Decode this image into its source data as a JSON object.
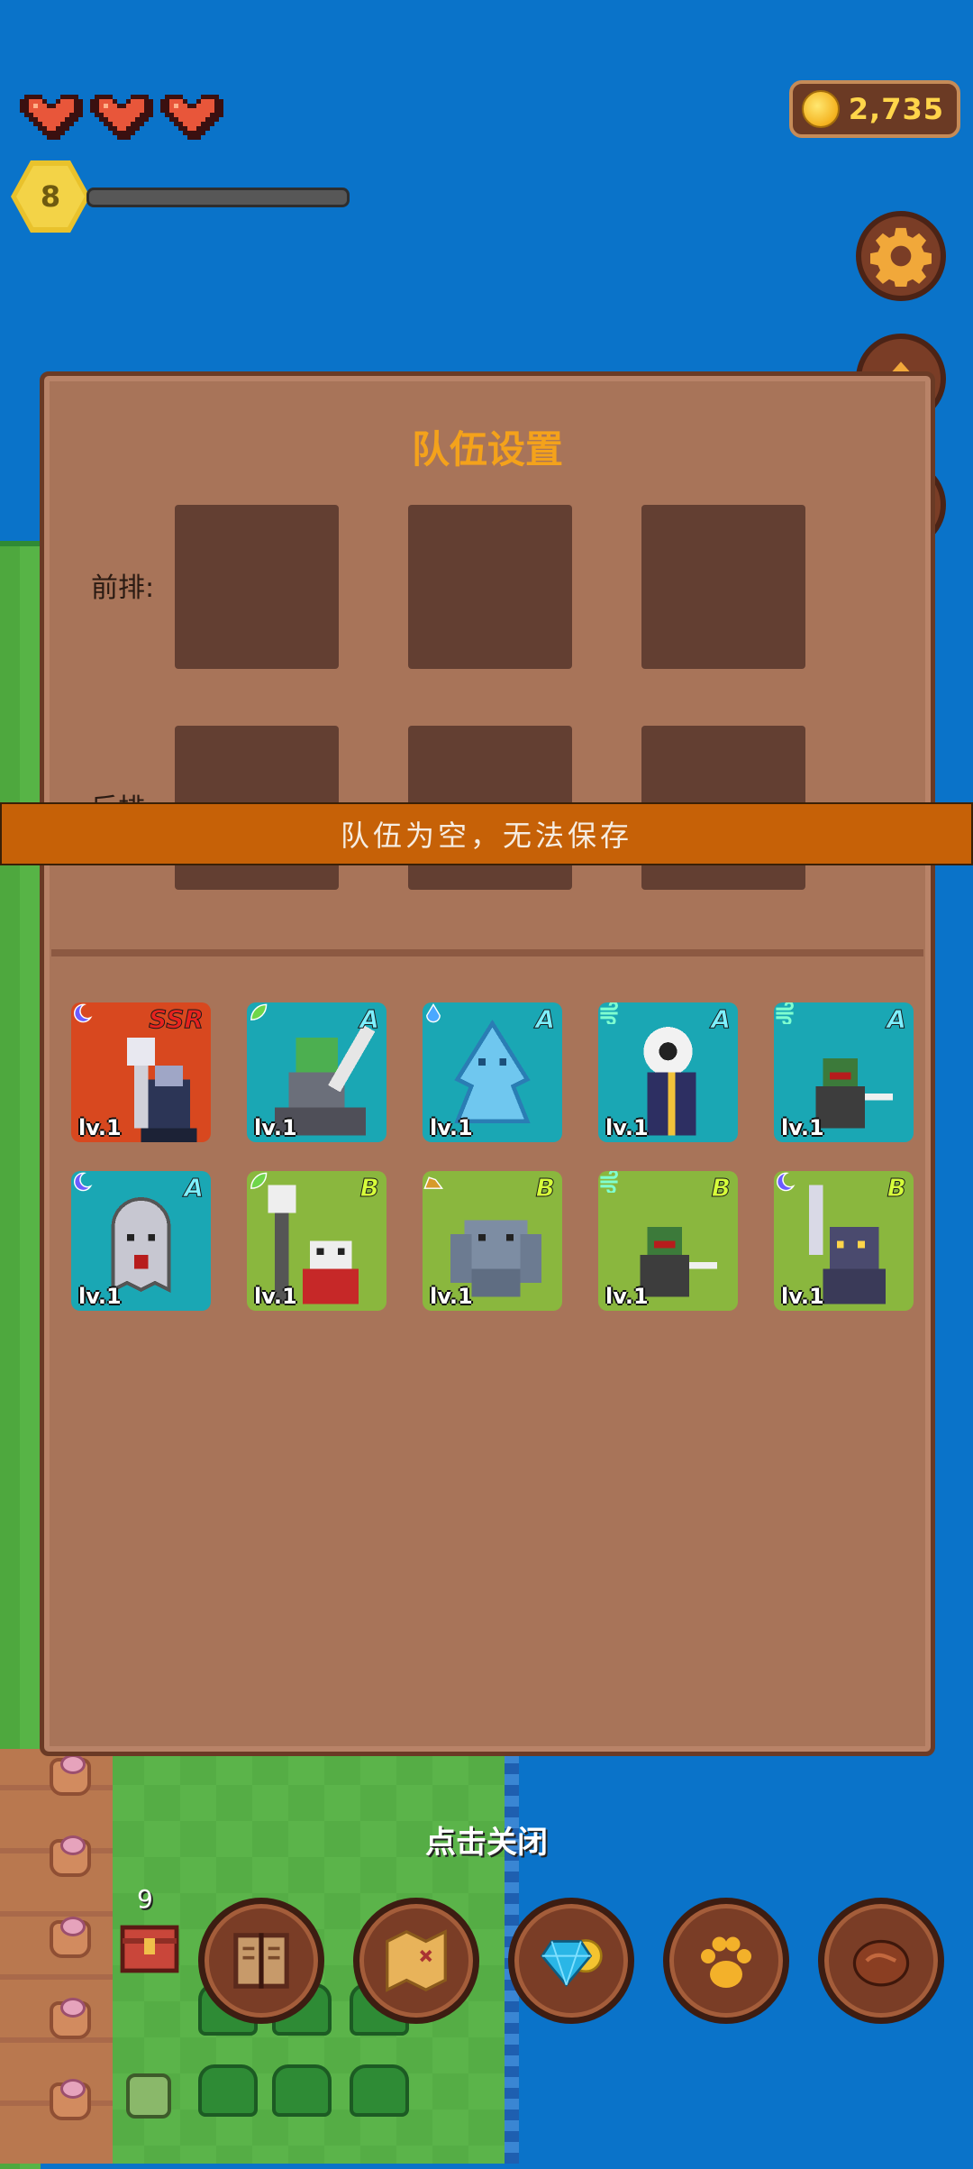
{
  "hud": {
    "hearts": 3,
    "coins": "2,735",
    "level": "8",
    "xp_progress": 0.0
  },
  "dialog": {
    "title": "队伍设置",
    "front_row_label": "前排:",
    "back_row_label": "后排:",
    "front_slots": 3,
    "back_slots": 3
  },
  "roster": [
    {
      "rarity": "SSR",
      "level": "lv.1",
      "element": "moon",
      "bg": "#d8481f",
      "char": "necromancer"
    },
    {
      "rarity": "A",
      "level": "lv.1",
      "element": "leaf",
      "bg": "#1aa7b4",
      "char": "orc-rider"
    },
    {
      "rarity": "A",
      "level": "lv.1",
      "element": "water",
      "bg": "#1aa7b4",
      "char": "water-spirit"
    },
    {
      "rarity": "A",
      "level": "lv.1",
      "element": "wind",
      "bg": "#1aa7b4",
      "char": "eyeball-mage"
    },
    {
      "rarity": "A",
      "level": "lv.1",
      "element": "wind",
      "bg": "#1aa7b4",
      "char": "goblin-thief"
    },
    {
      "rarity": "A",
      "level": "lv.1",
      "element": "moon",
      "bg": "#1aa7b4",
      "char": "ghost"
    },
    {
      "rarity": "B",
      "level": "lv.1",
      "element": "leaf",
      "bg": "#8ab73e",
      "char": "skeleton-shaman"
    },
    {
      "rarity": "B",
      "level": "lv.1",
      "element": "earth",
      "bg": "#8ab73e",
      "char": "stone-golem"
    },
    {
      "rarity": "B",
      "level": "lv.1",
      "element": "wind",
      "bg": "#8ab73e",
      "char": "goblin-thief"
    },
    {
      "rarity": "B",
      "level": "lv.1",
      "element": "moon",
      "bg": "#8ab73e",
      "char": "dark-knight"
    }
  ],
  "colors": {
    "rarity_SSR": "#e8231e",
    "rarity_A": "#7ef0ff",
    "rarity_B": "#d6ff3a"
  },
  "toast": "队伍为空，无法保存",
  "close_hint": "点击关闭",
  "inventory_badge": "9",
  "bottom_bar": [
    "book-icon",
    "map-scroll-icon",
    "gem-shop-icon",
    "paw-icon",
    "meat-icon"
  ],
  "side_buttons": [
    "gear-icon",
    "upgrade-arrow-icon"
  ]
}
